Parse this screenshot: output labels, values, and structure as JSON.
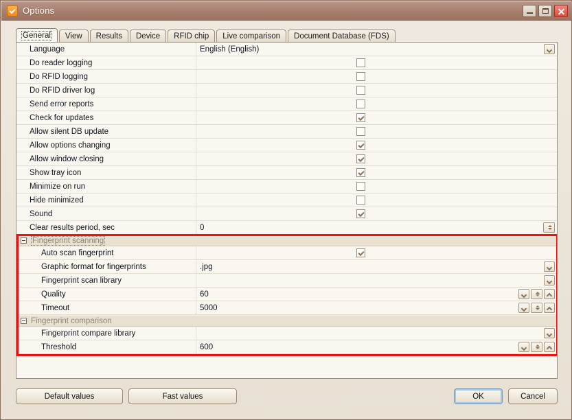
{
  "window": {
    "title": "Options",
    "icon": "checkbox-orange-icon",
    "buttons": {
      "minimize": "minimize-icon",
      "maximize": "maximize-icon",
      "close": "close-icon"
    }
  },
  "tabs": [
    {
      "label": "General",
      "active": true
    },
    {
      "label": "View",
      "active": false
    },
    {
      "label": "Results",
      "active": false
    },
    {
      "label": "Device",
      "active": false
    },
    {
      "label": "RFID chip",
      "active": false
    },
    {
      "label": "Live comparison",
      "active": false
    },
    {
      "label": "Document Database (FDS)",
      "active": false
    }
  ],
  "grid": {
    "rows": [
      {
        "type": "option",
        "label": "Language",
        "value": "English (English)",
        "control": "dropdown"
      },
      {
        "type": "option",
        "label": "Do reader logging",
        "value": "",
        "control": "checkbox",
        "checked": false
      },
      {
        "type": "option",
        "label": "Do RFID logging",
        "value": "",
        "control": "checkbox",
        "checked": false
      },
      {
        "type": "option",
        "label": "Do RFID driver log",
        "value": "",
        "control": "checkbox",
        "checked": false
      },
      {
        "type": "option",
        "label": "Send error reports",
        "value": "",
        "control": "checkbox",
        "checked": false
      },
      {
        "type": "option",
        "label": "Check for updates",
        "value": "",
        "control": "checkbox",
        "checked": true
      },
      {
        "type": "option",
        "label": "Allow silent DB update",
        "value": "",
        "control": "checkbox",
        "checked": false
      },
      {
        "type": "option",
        "label": "Allow options changing",
        "value": "",
        "control": "checkbox",
        "checked": true
      },
      {
        "type": "option",
        "label": "Allow window closing",
        "value": "",
        "control": "checkbox",
        "checked": true
      },
      {
        "type": "option",
        "label": "Show tray icon",
        "value": "",
        "control": "checkbox",
        "checked": true
      },
      {
        "type": "option",
        "label": "Minimize on run",
        "value": "",
        "control": "checkbox",
        "checked": false
      },
      {
        "type": "option",
        "label": "Hide minimized",
        "value": "",
        "control": "checkbox",
        "checked": false
      },
      {
        "type": "option",
        "label": "Sound",
        "value": "",
        "control": "checkbox",
        "checked": true
      },
      {
        "type": "option",
        "label": "Clear results period, sec",
        "value": "0",
        "control": "spinner"
      },
      {
        "type": "group",
        "label": "Fingerprint scanning",
        "expanded": true,
        "focused": true
      },
      {
        "type": "option",
        "sub": true,
        "label": "Auto scan fingerprint",
        "value": "",
        "control": "checkbox",
        "checked": true
      },
      {
        "type": "option",
        "sub": true,
        "label": "Graphic format for fingerprints",
        "value": ".jpg",
        "control": "dropdown"
      },
      {
        "type": "option",
        "sub": true,
        "label": "Fingerprint scan library",
        "value": "",
        "control": "dropdown"
      },
      {
        "type": "option",
        "sub": true,
        "label": "Quality",
        "value": "60",
        "control": "stepper"
      },
      {
        "type": "option",
        "sub": true,
        "label": "Timeout",
        "value": "5000",
        "control": "stepper"
      },
      {
        "type": "group",
        "label": "Fingerprint comparison",
        "expanded": true,
        "focused": false
      },
      {
        "type": "option",
        "sub": true,
        "label": "Fingerprint compare library",
        "value": "",
        "control": "dropdown"
      },
      {
        "type": "option",
        "sub": true,
        "label": "Threshold",
        "value": "600",
        "control": "stepper"
      }
    ]
  },
  "highlight": {
    "color": "#ee1111",
    "start_row_index": 14,
    "end_row_index": 22
  },
  "footer": {
    "default_values_label": "Default values",
    "fast_values_label": "Fast values",
    "ok_label": "OK",
    "cancel_label": "Cancel"
  }
}
